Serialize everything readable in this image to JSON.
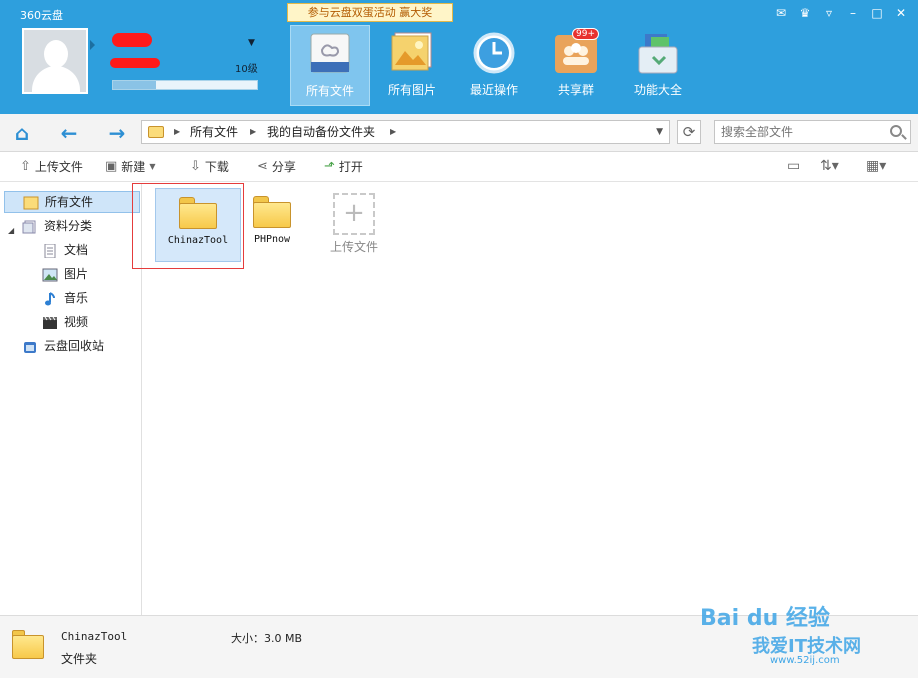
{
  "app": {
    "title": "360云盘",
    "promo": "参与云盘双蛋活动 赢大奖"
  },
  "user": {
    "level": "10级",
    "quota_fraction": 0.3
  },
  "nav": [
    {
      "label": "所有文件",
      "icon": "disk-icon",
      "active": true
    },
    {
      "label": "所有图片",
      "icon": "picture-icon"
    },
    {
      "label": "最近操作",
      "icon": "clock-icon"
    },
    {
      "label": "共享群",
      "icon": "group-icon",
      "badge": "99+"
    },
    {
      "label": "功能大全",
      "icon": "toolbox-icon"
    }
  ],
  "address": {
    "crumbs": [
      "所有文件",
      "我的自动备份文件夹"
    ],
    "search_placeholder": "搜索全部文件"
  },
  "toolbar": {
    "upload": "上传文件",
    "new": "新建",
    "download": "下载",
    "share": "分享",
    "open": "打开"
  },
  "sidebar": {
    "items": [
      {
        "label": "所有文件"
      },
      {
        "label": "资料分类"
      },
      {
        "label": "文档"
      },
      {
        "label": "图片"
      },
      {
        "label": "音乐"
      },
      {
        "label": "视频"
      },
      {
        "label": "云盘回收站"
      }
    ]
  },
  "files": [
    {
      "name": "ChinazTool",
      "selected": true
    },
    {
      "name": "PHPnow",
      "selected": false
    }
  ],
  "upload_tile_label": "上传文件",
  "status": {
    "name": "ChinazTool",
    "type": "文件夹",
    "size": "大小：3.0 MB"
  },
  "watermark": {
    "main": "Bai du 经验",
    "site": "我爱IT技术网",
    "url": "www.52ij.com"
  },
  "colors": {
    "header": "#2e9fdd",
    "accent": "#2d8fd3",
    "selection": "#d5e8fa",
    "highlight_box": "#e53c3c"
  }
}
